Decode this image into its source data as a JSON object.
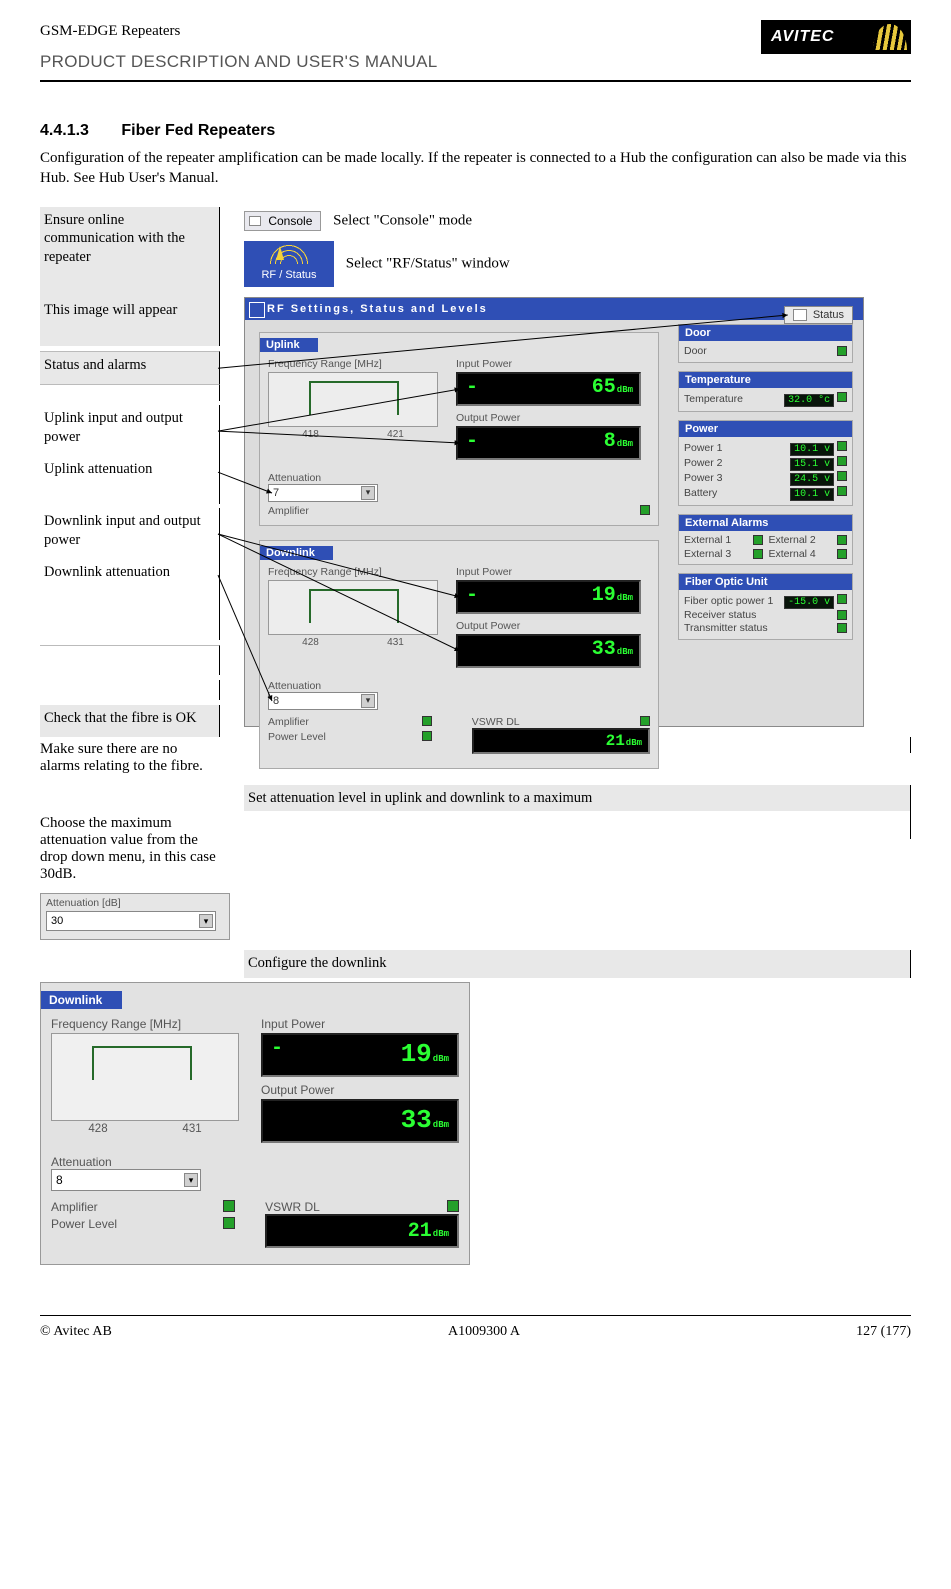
{
  "header": {
    "top": "GSM-EDGE Repeaters",
    "sub": "PRODUCT DESCRIPTION AND USER'S MANUAL",
    "logo": "AVITEC"
  },
  "section": {
    "num": "4.4.1.3",
    "title": "Fiber Fed Repeaters"
  },
  "lead": "Configuration of the repeater amplification can be made locally. If the repeater is connected to a Hub the configuration can also be made via this Hub. See Hub User's Manual.",
  "steps": {
    "s1": "Ensure online communication with the repeater",
    "s1_console_label": "Console",
    "s1_console_text": "Select \"Console\" mode",
    "s1_rf_label": "RF / Status",
    "s1_rf_text": "Select \"RF/Status\" window",
    "s2": "This image will appear",
    "s3": "Status and alarms",
    "s4": "Uplink input and output power",
    "s5": "Uplink attenuation",
    "s6": "Downlink input and output power",
    "s7": "Downlink attenuation",
    "s8": "Check that the fibre is OK",
    "s8_r": "Make sure there are no alarms relating to the fibre.",
    "s9": "Set attenuation level in uplink and downlink to a maximum",
    "s9_r": "Choose the maximum attenuation value from the drop down menu, in this case 30dB.",
    "s10": "Configure the downlink"
  },
  "rfpanel": {
    "title": "RF Settings, Status and Levels",
    "status_btn": "Status",
    "uplink": {
      "title": "Uplink",
      "freq_label": "Frequency Range [MHz]",
      "f_lo": "418",
      "f_hi": "421",
      "att_label": "Attenuation",
      "att_val": "7",
      "amp_label": "Amplifier",
      "in_label": "Input Power",
      "in_val": "65",
      "in_unit": "dBm",
      "out_label": "Output Power",
      "out_val": "8",
      "out_unit": "dBm"
    },
    "downlink": {
      "title": "Downlink",
      "freq_label": "Frequency Range [MHz]",
      "f_lo": "428",
      "f_hi": "431",
      "att_label": "Attenuation",
      "att_val": "8",
      "amp_label": "Amplifier",
      "pl_label": "Power Level",
      "in_label": "Input Power",
      "in_val": "19",
      "in_unit": "dBm",
      "out_label": "Output Power",
      "out_val": "33",
      "out_unit": "dBm",
      "vswr_label": "VSWR DL",
      "vswr_val": "21",
      "vswr_unit": "dBm"
    },
    "side": {
      "door_t": "Door",
      "door_l": "Door",
      "temp_t": "Temperature",
      "temp_l": "Temperature",
      "temp_v": "32.0 °c",
      "pwr_t": "Power",
      "p1_l": "Power 1",
      "p1_v": "10.1 v",
      "p2_l": "Power 2",
      "p2_v": "15.1 v",
      "p3_l": "Power 3",
      "p3_v": "24.5 v",
      "bat_l": "Battery",
      "bat_v": "10.1 v",
      "ext_t": "External Alarms",
      "e1": "External 1",
      "e2": "External 2",
      "e3": "External 3",
      "e4": "External 4",
      "fou_t": "Fiber Optic Unit",
      "fop_l": "Fiber optic power 1",
      "fop_v": "-15.0 v",
      "rcv_l": "Receiver status",
      "tx_l": "Transmitter status"
    }
  },
  "att_widget": {
    "label": "Attenuation [dB]",
    "value": "30"
  },
  "dl_panel": {
    "title": "Downlink",
    "freq_label": "Frequency Range [MHz]",
    "f_lo": "428",
    "f_hi": "431",
    "att_label": "Attenuation",
    "att_val": "8",
    "amp_label": "Amplifier",
    "pl_label": "Power Level",
    "in_label": "Input Power",
    "in_val": "19",
    "in_unit": "dBm",
    "out_label": "Output Power",
    "out_val": "33",
    "out_unit": "dBm",
    "vswr_label": "VSWR DL",
    "vswr_val": "21",
    "vswr_unit": "dBm"
  },
  "footer": {
    "left": "© Avitec AB",
    "center": "A1009300 A",
    "right": "127 (177)"
  }
}
